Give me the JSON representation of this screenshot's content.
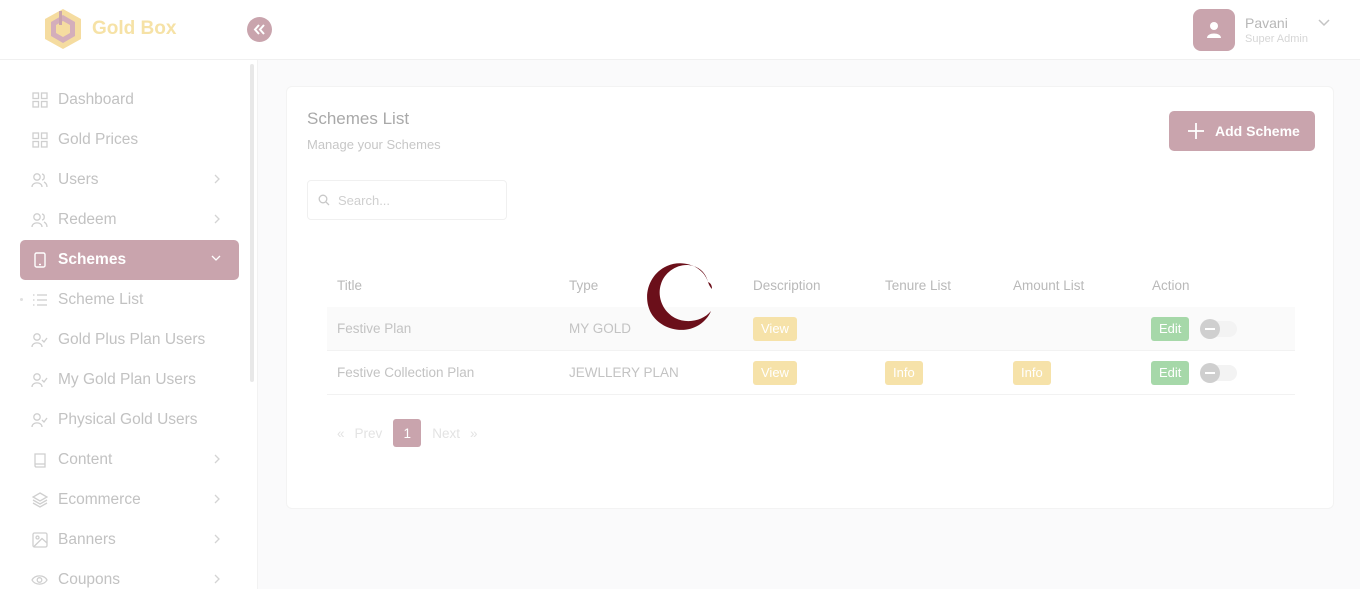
{
  "app": {
    "name": "Gold Box"
  },
  "header": {
    "user_name": "Pavani",
    "user_role": "Super Admin"
  },
  "sidebar": {
    "items": [
      {
        "label": "Dashboard",
        "icon": "grid-icon"
      },
      {
        "label": "Gold Prices",
        "icon": "grid-icon"
      },
      {
        "label": "Users",
        "icon": "users-icon"
      },
      {
        "label": "Redeem",
        "icon": "users-icon"
      },
      {
        "label": "Schemes",
        "icon": "tablet-icon"
      },
      {
        "label": "Scheme List",
        "icon": "list-icon"
      },
      {
        "label": "Gold Plus Plan Users",
        "icon": "user-check-icon"
      },
      {
        "label": "My Gold Plan Users",
        "icon": "user-check-icon"
      },
      {
        "label": "Physical Gold Users",
        "icon": "user-check-icon"
      },
      {
        "label": "Content",
        "icon": "book-icon"
      },
      {
        "label": "Ecommerce",
        "icon": "layers-icon"
      },
      {
        "label": "Banners",
        "icon": "image-icon"
      },
      {
        "label": "Coupons",
        "icon": "eye-icon"
      }
    ],
    "active": "Schemes"
  },
  "main": {
    "title": "Schemes List",
    "subtitle": "Manage your Schemes",
    "add_button": "Add Scheme",
    "search_placeholder": "Search...",
    "table": {
      "columns": [
        "Title",
        "Type",
        "Description",
        "Tenure List",
        "Amount List",
        "Action"
      ],
      "rows": [
        {
          "title": "Festive Plan",
          "type": "MY GOLD",
          "description": "View",
          "tenure": "",
          "amount": "",
          "action": "Edit"
        },
        {
          "title": "Festive Collection Plan",
          "type": "JEWLLERY PLAN",
          "description": "View",
          "tenure": "Info",
          "amount": "Info",
          "action": "Edit"
        }
      ]
    },
    "pagination": {
      "prev": "Prev",
      "current": "1",
      "next": "Next"
    }
  },
  "colors": {
    "accent": "#c9a4ad",
    "spinner": "#6b0f1a",
    "view_badge": "#f6e2a9",
    "edit_badge": "#a6d8a9"
  }
}
